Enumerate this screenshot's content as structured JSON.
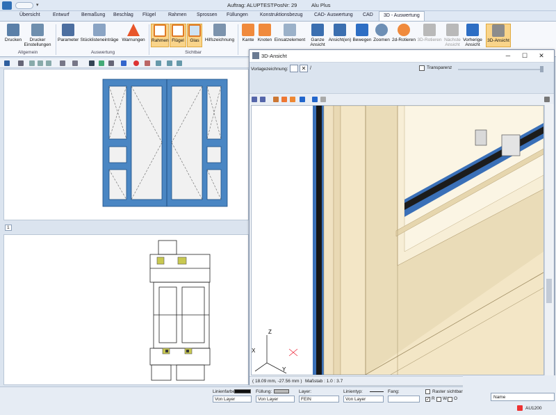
{
  "titlebar": {
    "order_label": "Auftrag: ALUPTEST",
    "pos_label": "PosNr: 29",
    "product_label": "Alu Plus"
  },
  "tabs": [
    "Übersicht",
    "Entwurf",
    "Bemaßung",
    "Beschlag",
    "Flügel",
    "Rahmen",
    "Sprossen",
    "Füllungen",
    "Konstruktionsbezug",
    "CAD- Auswertung",
    "CAD",
    "3D - Auswertung"
  ],
  "active_tab": "3D - Auswertung",
  "ribbon": {
    "allgemein": {
      "label": "Allgemein",
      "buttons": [
        "Drucken",
        "Drucker Einstellungen"
      ]
    },
    "auswertung": {
      "label": "Auswertung",
      "buttons": [
        "Parameter",
        "Stücklisteneinträge",
        "Warnungen"
      ]
    },
    "sichtbar": {
      "label": "Sichtbar",
      "buttons": [
        "Rahmen",
        "Flügel",
        "Glas",
        "Hilfszeichnung"
      ]
    },
    "view_buttons": [
      "Kante",
      "Knoten",
      "Einsatzelement",
      "Ganze Ansicht",
      "Ansicht(en)",
      "Bewegen",
      "Zoomen",
      "2d-Rotieren",
      "3D-Rotieren",
      "Nächste Ansicht",
      "Vorherige Ansicht",
      "3D-Ansicht"
    ]
  },
  "pane_tab": "1",
  "win3d": {
    "title": "3D-Ansicht",
    "vorlage_label": "Vorlagezeichnung:",
    "vorlage_value": "/",
    "transparenz_label": "Transparenz",
    "coords": "( 18.09 mm, -27.56 mm )",
    "scale": "Maßstab : 1.0 : 3.7",
    "axis_z": "Z",
    "axis_x": "X",
    "axis_y": "Y"
  },
  "status": {
    "linienfarbe_label": "Linienfarbe:",
    "linienfarbe_value": "Von Layer",
    "fuellung_label": "Füllung:",
    "fuellung_value": "Von Layer",
    "layer_label": "Layer:",
    "layer_value": "FEIN",
    "linientyp_label": "Linientyp:",
    "linientyp_value": "Von Layer",
    "fang_label": "Fang:",
    "raster_label": "Raster sichtbar",
    "raster_opts": [
      "R",
      "W",
      "O"
    ],
    "name_label": "Name",
    "au_label": "AU1200"
  },
  "colors": {
    "frame_blue": "#4a86c3",
    "profile_tan": "#efe0bc",
    "accent_orange": "#f9d48a"
  }
}
